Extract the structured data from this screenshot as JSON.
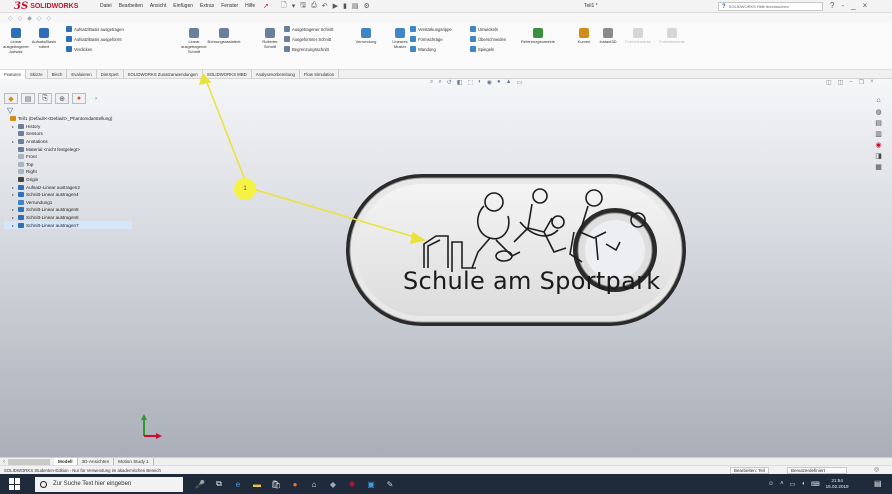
{
  "app": {
    "logo_mark": "3S",
    "logo_text": "SOLIDWORKS",
    "document_title": "Teil1 *",
    "help_search_placeholder": "SOLIDWORKS Hilfe durchsuchen",
    "window_controls": [
      "?",
      "-",
      "_",
      "×"
    ]
  },
  "menu": [
    "Datei",
    "Bearbeiten",
    "Ansicht",
    "Einfügen",
    "Extras",
    "Fenster",
    "Hilfe"
  ],
  "ribbon": {
    "large": [
      {
        "label": "Linear ausgetragener Aufsatz",
        "color": "#2f6fb7"
      },
      {
        "label": "Aufsatz/Basis rotiert",
        "color": "#2f6fb7"
      },
      {
        "label": "Linear ausgetragener Schnitt",
        "color": "#6a7f9a"
      },
      {
        "label": "Bohrungsassistent",
        "color": "#6a7f9a"
      },
      {
        "label": "Rotierter Schnitt",
        "color": "#6a7f9a"
      },
      {
        "label": "Verrundung",
        "color": "#3f86c8"
      },
      {
        "label": "Lineares Muster",
        "color": "#3f86c8"
      },
      {
        "label": "Referenzgeometrie",
        "color": "#3a8f3a"
      },
      {
        "label": "Kurven",
        "color": "#d38b1a"
      },
      {
        "label": "Instant3D",
        "color": "#8a8a8a"
      }
    ],
    "small": [
      {
        "label": "Aufsatz/Basis ausgetragen",
        "color": "#2f6fb7"
      },
      {
        "label": "Aufsatz/Basis ausgeformt",
        "color": "#2f6fb7"
      },
      {
        "label": "Verdicken",
        "color": "#2f6fb7"
      },
      {
        "label": "Ausgetragener Schnitt",
        "color": "#6a7f9a"
      },
      {
        "label": "Ausgeformter Schnitt",
        "color": "#6a7f9a"
      },
      {
        "label": "Begrenzungsschnitt",
        "color": "#6a7f9a"
      },
      {
        "label": "Verstärkungsrippe",
        "color": "#3f86c8"
      },
      {
        "label": "Formschräge",
        "color": "#3f86c8"
      },
      {
        "label": "Wandung",
        "color": "#3f86c8"
      },
      {
        "label": "Umwickeln",
        "color": "#3f86c8"
      },
      {
        "label": "Überschneiden",
        "color": "#3f86c8"
      },
      {
        "label": "Spiegeln",
        "color": "#3f86c8"
      }
    ],
    "disabled": [
      "Formelemente",
      "Formelemente"
    ]
  },
  "tabs": [
    "Features",
    "Skizze",
    "Blech",
    "Evaluieren",
    "DimXpert",
    "SOLIDWORKS Zusatzanwendungen",
    "SOLIDWORKS MBD",
    "Analysevorbereitung",
    "Flow Simulation"
  ],
  "feature_tree": [
    {
      "label": "Teil1 (Default<<Default>_Phantomdarstellung)",
      "color": "#d38b1a",
      "indent": 0,
      "toggle": ""
    },
    {
      "label": "History",
      "color": "#6a7f9a",
      "indent": 1,
      "toggle": "▸"
    },
    {
      "label": "Sensors",
      "color": "#6a7f9a",
      "indent": 1,
      "toggle": ""
    },
    {
      "label": "Anotations",
      "color": "#6a7f9a",
      "indent": 1,
      "toggle": "▸"
    },
    {
      "label": "Material <nicht festgelegt>",
      "color": "#6a7f9a",
      "indent": 1,
      "toggle": ""
    },
    {
      "label": "Front",
      "color": "#a9b4c2",
      "indent": 1,
      "toggle": ""
    },
    {
      "label": "Top",
      "color": "#a9b4c2",
      "indent": 1,
      "toggle": ""
    },
    {
      "label": "Right",
      "color": "#a9b4c2",
      "indent": 1,
      "toggle": ""
    },
    {
      "label": "Origin",
      "color": "#444",
      "indent": 1,
      "toggle": ""
    },
    {
      "label": "Aufsatz-Linear austragen2",
      "color": "#2f6fb7",
      "indent": 1,
      "toggle": "▸"
    },
    {
      "label": "Schnitt-Linear austragen4",
      "color": "#2f6fb7",
      "indent": 1,
      "toggle": "▸"
    },
    {
      "label": "Verrundung1",
      "color": "#3f86c8",
      "indent": 1,
      "toggle": ""
    },
    {
      "label": "Schnitt-Linear austragen5",
      "color": "#2f6fb7",
      "indent": 1,
      "toggle": "▸"
    },
    {
      "label": "Schnitt-Linear austragen6",
      "color": "#2f6fb7",
      "indent": 1,
      "toggle": "▸"
    },
    {
      "label": "Schnitt-Linear austragen7",
      "color": "#2f6fb7",
      "indent": 1,
      "toggle": "▸",
      "selected": true
    }
  ],
  "part": {
    "engraved_text": "Schule am Sportpark"
  },
  "annotation": {
    "callout_label": "1"
  },
  "model_tabs": [
    "Modell",
    "3D-Ansichten",
    "Motion Study 1"
  ],
  "status": {
    "message": "SOLIDWORKS Studenten-Edition - Nur für Verwendung im akademischen Bereich",
    "mode": "Bearbeiten: Teil",
    "units": "Benutzerdefiniert"
  },
  "taskbar": {
    "search_placeholder": "Zur Suche Text hier eingeben",
    "time": "21:54",
    "date": "15.02.2019"
  }
}
